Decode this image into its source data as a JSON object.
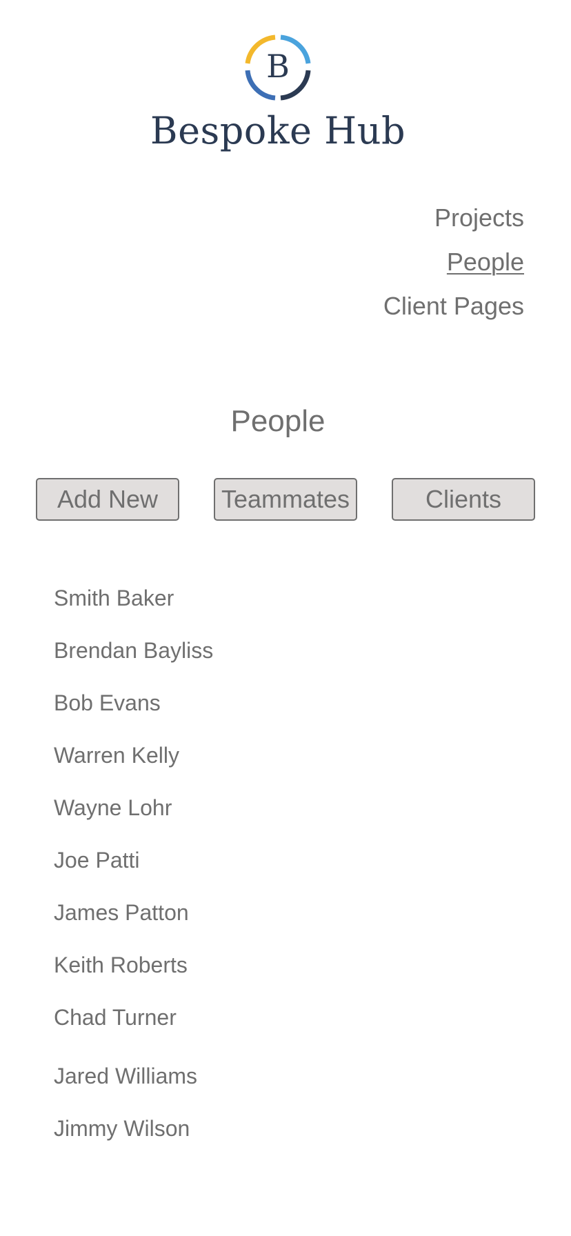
{
  "brand": {
    "initial": "B",
    "name": "Bespoke Hub"
  },
  "nav": {
    "items": [
      {
        "label": "Projects",
        "active": false
      },
      {
        "label": "People",
        "active": true
      },
      {
        "label": "Client Pages",
        "active": false
      }
    ]
  },
  "page": {
    "title": "People"
  },
  "filters": {
    "add_new": "Add New",
    "teammates": "Teammates",
    "clients": "Clients"
  },
  "people": [
    "Smith Baker",
    "Brendan Bayliss",
    "Bob Evans",
    "Warren Kelly",
    "Wayne Lohr",
    "Joe Patti",
    "James Patton",
    "Keith Roberts",
    "Chad Turner",
    "Jared Williams",
    "Jimmy Wilson"
  ],
  "colors": {
    "text": "#6f6f6f",
    "brand_navy": "#2b3a52",
    "brand_yellow": "#f3b82c",
    "brand_blue": "#4aa3dd",
    "button_bg": "#e1dedd"
  }
}
